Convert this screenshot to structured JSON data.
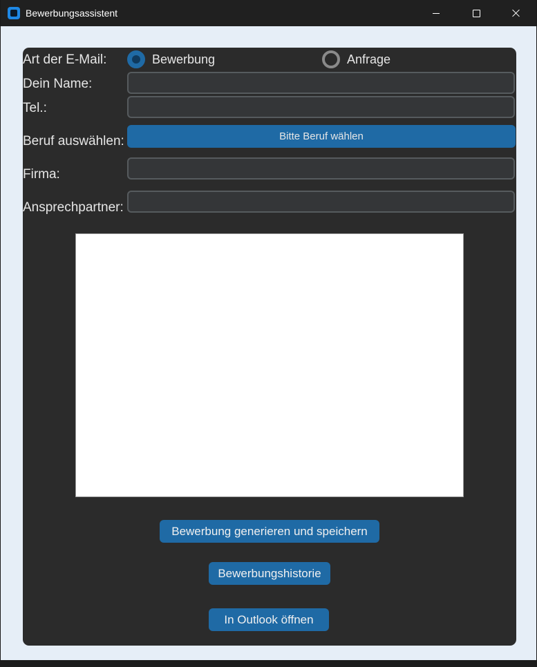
{
  "window": {
    "title": "Bewerbungsassistent"
  },
  "form": {
    "email_type_label": "Art der E-Mail:",
    "email_type_options": [
      {
        "label": "Bewerbung",
        "selected": true
      },
      {
        "label": "Anfrage",
        "selected": false
      }
    ],
    "name_label": "Dein Name:",
    "name_value": "",
    "phone_label": "Tel.:",
    "phone_value": "",
    "job_label": "Beruf auswählen:",
    "job_button_label": "Bitte Beruf wählen",
    "company_label": "Firma:",
    "company_value": "",
    "contact_label": "Ansprechpartner:",
    "contact_value": ""
  },
  "preview": {
    "text": ""
  },
  "actions": {
    "generate_label": "Bewerbung generieren und speichern",
    "history_label": "Bewerbungshistorie",
    "outlook_label": "In Outlook öffnen"
  },
  "colors": {
    "accent": "#1f6aa5",
    "panel_background": "#2b2b2b",
    "entry_background": "#343638",
    "entry_border": "#565b5e",
    "window_background": "#e6eef7",
    "titlebar": "#202020"
  }
}
